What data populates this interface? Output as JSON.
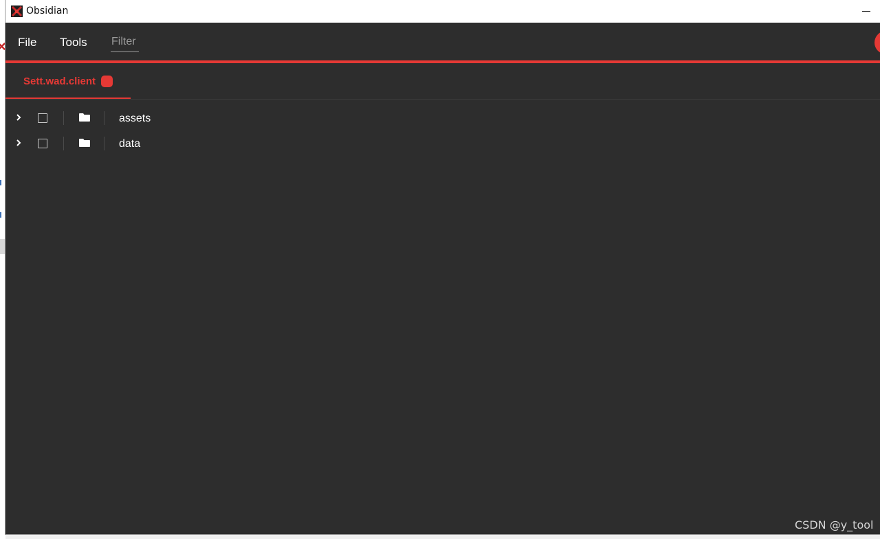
{
  "window": {
    "title": "Obsidian",
    "app_icon": "obsidian-logo-icon"
  },
  "menu": {
    "file": "File",
    "tools": "Tools",
    "filter_placeholder": "Filter"
  },
  "tabs": [
    {
      "label": "Sett.wad.client",
      "active": true
    }
  ],
  "tree": {
    "items": [
      {
        "name": "assets",
        "icon": "folder-icon",
        "expanded": false,
        "checked": false
      },
      {
        "name": "data",
        "icon": "folder-icon",
        "expanded": false,
        "checked": false
      }
    ]
  },
  "watermark": "CSDN @y_tool",
  "colors": {
    "accent": "#e53935",
    "background": "#2d2d2d",
    "titlebar": "#ffffff"
  }
}
